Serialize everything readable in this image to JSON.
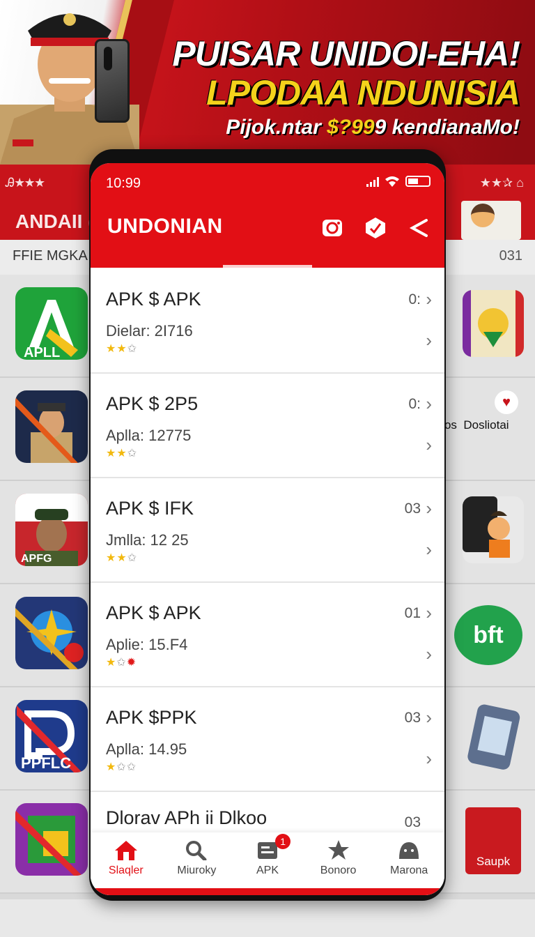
{
  "banner": {
    "headline1": "PUISAR UNIDOI-EHA!",
    "headline2": "LPODAA NDUNISIA",
    "headline3_prefix": "Pijok.ntar ",
    "headline3_price": "$?99",
    "headline3_suffix": "9 kendianaMo!"
  },
  "background": {
    "ratings_left": "Ꭿ★★★",
    "ratings_right": "★★✰ ⌂",
    "title": "ANDAII (",
    "subtitle": "FFIE MGKA",
    "subtitle_right": "031",
    "right_labels": [
      "okos",
      "Dosliotai"
    ],
    "right_badge_text": "bft",
    "saupk_label": "Saupk",
    "icon_labels": [
      "APLL",
      "APFG",
      "PPFLC"
    ]
  },
  "phone": {
    "status_time": "10:99",
    "app_title": "UNDONIAN",
    "actions": [
      "camera-icon",
      "shield-check-icon",
      "share-icon"
    ],
    "items": [
      {
        "name": "APK $ APK",
        "meta": "Dielar: 2I716",
        "count": "0:",
        "stars": "2/3"
      },
      {
        "name": "APK $ 2P5",
        "meta": "Aplla: 12775",
        "count": "0:",
        "stars": "2/3"
      },
      {
        "name": "APK $ IFK",
        "meta": "Jmlla: 12 25",
        "count": "03",
        "stars": "2/3"
      },
      {
        "name": "APK $ APK",
        "meta": "Aplie: 15.F4",
        "count": "01",
        "stars": "1/3 red"
      },
      {
        "name": "APK $PPK",
        "meta": "Aplla: 14.95",
        "count": "03",
        "stars": "1/3"
      },
      {
        "name": "Dlorav APh ii Dlkoo",
        "count": "03"
      }
    ],
    "nav": [
      {
        "label": "Slaqler",
        "icon": "home-icon",
        "active": true
      },
      {
        "label": "Miuroky",
        "icon": "search-icon"
      },
      {
        "label": "APK",
        "icon": "apk-icon",
        "badge": "1"
      },
      {
        "label": "Bonoro",
        "icon": "star-icon"
      },
      {
        "label": "Marona",
        "icon": "profile-icon"
      }
    ]
  },
  "colors": {
    "brand_red": "#e20f15",
    "star_gold": "#f2b90f"
  }
}
